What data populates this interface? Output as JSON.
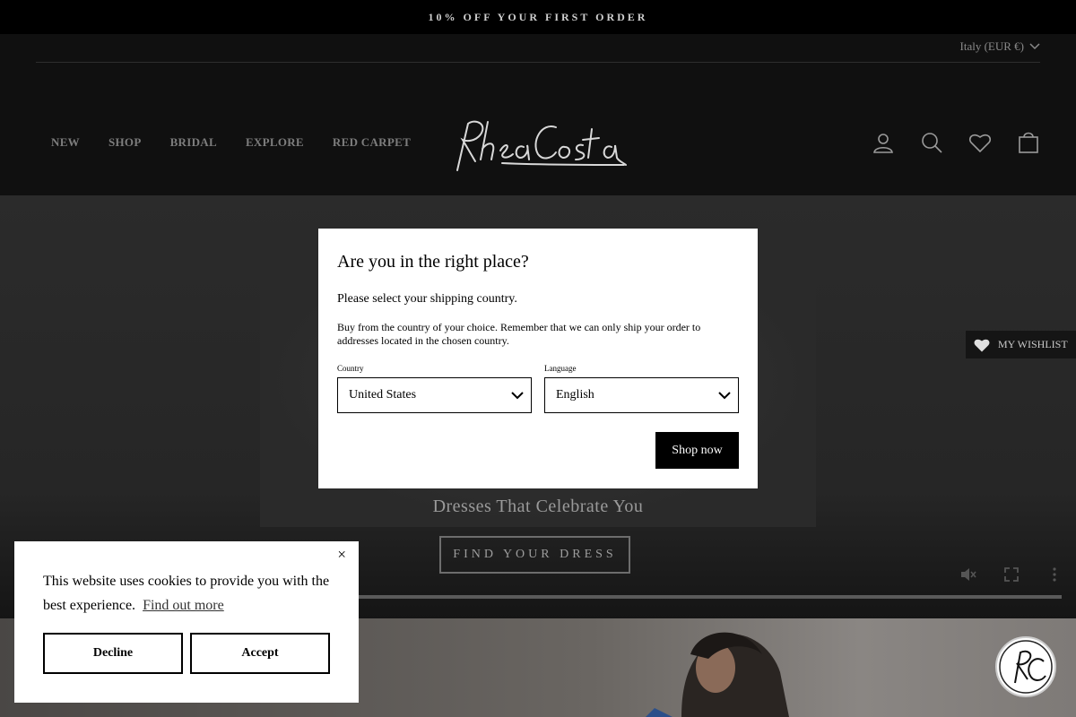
{
  "announcement": "10% OFF YOUR FIRST ORDER",
  "locale": {
    "label": "Italy (EUR €)"
  },
  "nav": [
    "NEW",
    "SHOP",
    "BRIDAL",
    "EXPLORE",
    "RED CARPET"
  ],
  "header_icons": [
    "user-icon",
    "search-icon",
    "heart-icon",
    "bag-icon"
  ],
  "hero": {
    "subtitle": "Dresses That Celebrate You",
    "cta": "FIND YOUR DRESS",
    "video_controls": [
      "mute-icon",
      "fullscreen-icon",
      "more-icon"
    ]
  },
  "wishlist": {
    "label": "MY WISHLIST"
  },
  "modal": {
    "title": "Are you in the right place?",
    "line1": "Please select your shipping country.",
    "line2": "Buy from the country of your choice. Remember that we can only ship your order to addresses located in the chosen country.",
    "country_label": "Country",
    "country_value": "United States",
    "language_label": "Language",
    "language_value": "English",
    "shop_button": "Shop now"
  },
  "cookie": {
    "text": "This website uses cookies to provide you with the best experience.",
    "link": "Find out more",
    "decline": "Decline",
    "accept": "Accept",
    "close": "×"
  },
  "colors": {
    "announcement_bg": "#000000",
    "header_bg": "#101010",
    "button_black": "#000000"
  }
}
